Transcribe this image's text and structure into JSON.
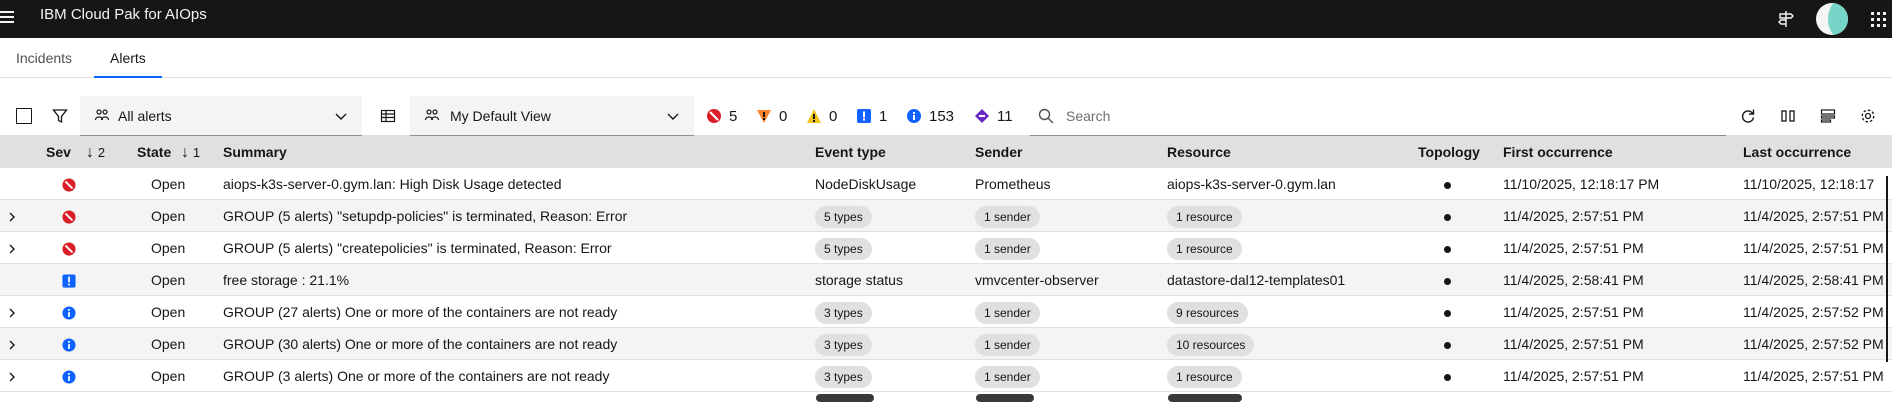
{
  "header": {
    "app_title": "IBM Cloud Pak for AIOps",
    "icons": [
      "menu-icon",
      "pin-icon",
      "avatar",
      "app-switcher-icon"
    ]
  },
  "tabs": [
    {
      "label": "Incidents",
      "active": false
    },
    {
      "label": "Alerts",
      "active": true
    }
  ],
  "toolbar": {
    "filter_dropdown": "All alerts",
    "view_dropdown": "My Default View",
    "counts": {
      "critical": "5",
      "major": "0",
      "minor": "0",
      "warning": "1",
      "information": "153",
      "indeterminate": "11"
    },
    "search_placeholder": "Search"
  },
  "table": {
    "headers": {
      "sev": "Sev",
      "sev_sort": "2",
      "state": "State",
      "state_sort": "1",
      "summary": "Summary",
      "event_type": "Event type",
      "sender": "Sender",
      "resource": "Resource",
      "topology": "Topology",
      "first": "First occurrence",
      "last": "Last occurrence"
    },
    "rows": [
      {
        "expandable": false,
        "severity": "critical",
        "state": "Open",
        "summary": "aiops-k3s-server-0.gym.lan: High Disk Usage detected",
        "event_type": "NodeDiskUsage",
        "event_type_tag": false,
        "sender": "Prometheus",
        "sender_tag": false,
        "resource": "aiops-k3s-server-0.gym.lan",
        "resource_tag": false,
        "first": "11/10/2025, 12:18:17 PM",
        "last": "11/10/2025, 12:18:17"
      },
      {
        "expandable": true,
        "severity": "critical",
        "state": "Open",
        "summary": "GROUP (5 alerts) \"setupdp-policies\" is terminated, Reason: Error",
        "event_type": "5 types",
        "event_type_tag": true,
        "sender": "1 sender",
        "sender_tag": true,
        "resource": "1 resource",
        "resource_tag": true,
        "first": "11/4/2025, 2:57:51 PM",
        "last": "11/4/2025, 2:57:51 PM"
      },
      {
        "expandable": true,
        "severity": "critical",
        "state": "Open",
        "summary": "GROUP (5 alerts) \"createpolicies\" is terminated, Reason: Error",
        "event_type": "5 types",
        "event_type_tag": true,
        "sender": "1 sender",
        "sender_tag": true,
        "resource": "1 resource",
        "resource_tag": true,
        "first": "11/4/2025, 2:57:51 PM",
        "last": "11/4/2025, 2:57:51 PM"
      },
      {
        "expandable": false,
        "severity": "warning",
        "state": "Open",
        "summary": "free storage : 21.1%",
        "event_type": "storage status",
        "event_type_tag": false,
        "sender": "vmvcenter-observer",
        "sender_tag": false,
        "resource": "datastore-dal12-templates01",
        "resource_tag": false,
        "first": "11/4/2025, 2:58:41 PM",
        "last": "11/4/2025, 2:58:41 PM"
      },
      {
        "expandable": true,
        "severity": "information",
        "state": "Open",
        "summary": "GROUP (27 alerts) One or more of the containers are not ready",
        "event_type": "3 types",
        "event_type_tag": true,
        "sender": "1 sender",
        "sender_tag": true,
        "resource": "9 resources",
        "resource_tag": true,
        "first": "11/4/2025, 2:57:51 PM",
        "last": "11/4/2025, 2:57:52 PM"
      },
      {
        "expandable": true,
        "severity": "information",
        "state": "Open",
        "summary": "GROUP (30 alerts) One or more of the containers are not ready",
        "event_type": "3 types",
        "event_type_tag": true,
        "sender": "1 sender",
        "sender_tag": true,
        "resource": "10 resources",
        "resource_tag": true,
        "first": "11/4/2025, 2:57:51 PM",
        "last": "11/4/2025, 2:57:52 PM"
      },
      {
        "expandable": true,
        "severity": "information",
        "state": "Open",
        "summary": "GROUP (3 alerts) One or more of the containers are not ready",
        "event_type": "3 types",
        "event_type_tag": true,
        "sender": "1 sender",
        "sender_tag": true,
        "resource": "1 resource",
        "resource_tag": true,
        "first": "11/4/2025, 2:57:51 PM",
        "last": "11/4/2025, 2:57:51 PM"
      }
    ]
  },
  "colors": {
    "critical": "#da1e28",
    "major": "#ff832b",
    "minor": "#f1c21b",
    "warning": "#0f62fe",
    "information": "#0f62fe",
    "indeterminate": "#6929c4",
    "accent": "#0f62fe"
  }
}
